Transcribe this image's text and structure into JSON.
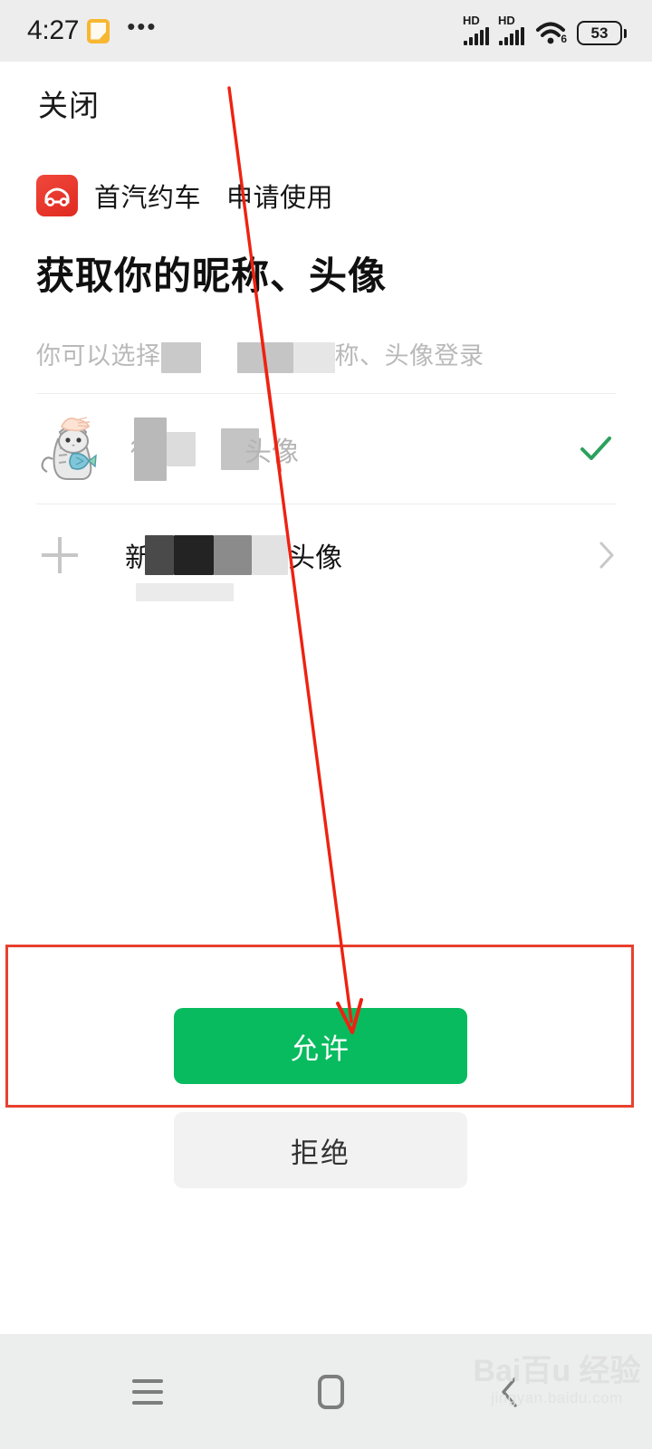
{
  "statusbar": {
    "time": "4:27",
    "note_icon": "note-icon",
    "more_dots": "•••",
    "hd_label_1": "HD",
    "hd_label_2": "HD",
    "wifi_icon": "wifi-icon",
    "wifi_generation": "6",
    "battery_percent": "53"
  },
  "header": {
    "close_label": "关闭"
  },
  "app": {
    "icon_name": "car-app-icon",
    "name": "首汽约车",
    "action": "申请使用"
  },
  "permission": {
    "title": "获取你的昵称、头像",
    "subtitle_prefix": "你可以选择",
    "subtitle_suffix": "称、头像登录"
  },
  "account_row": {
    "avatar_name": "cat-avatar",
    "name_prefix": "微",
    "name_suffix": "头像",
    "selected_icon": "check-icon",
    "selected": true
  },
  "new_avatar_row": {
    "plus_icon": "plus-icon",
    "label_prefix": "新",
    "label_suffix": "头像",
    "chevron_icon": "chevron-right-icon"
  },
  "actions": {
    "allow_label": "允许",
    "reject_label": "拒绝"
  },
  "annotation": {
    "highlight_color": "#e8402f",
    "arrow_color": "#ee2211",
    "target": "allow-button"
  },
  "navbar": {
    "menu_icon": "menu-icon",
    "home_icon": "home-icon",
    "back_icon": "back-icon"
  },
  "watermark": {
    "main": "Bai百u 经验",
    "sub": "jingyan.baidu.com"
  },
  "colors": {
    "brand_green": "#09bb5f",
    "app_red": "#e02a20",
    "status_bg": "#ededed",
    "nav_bg": "#eceded"
  }
}
